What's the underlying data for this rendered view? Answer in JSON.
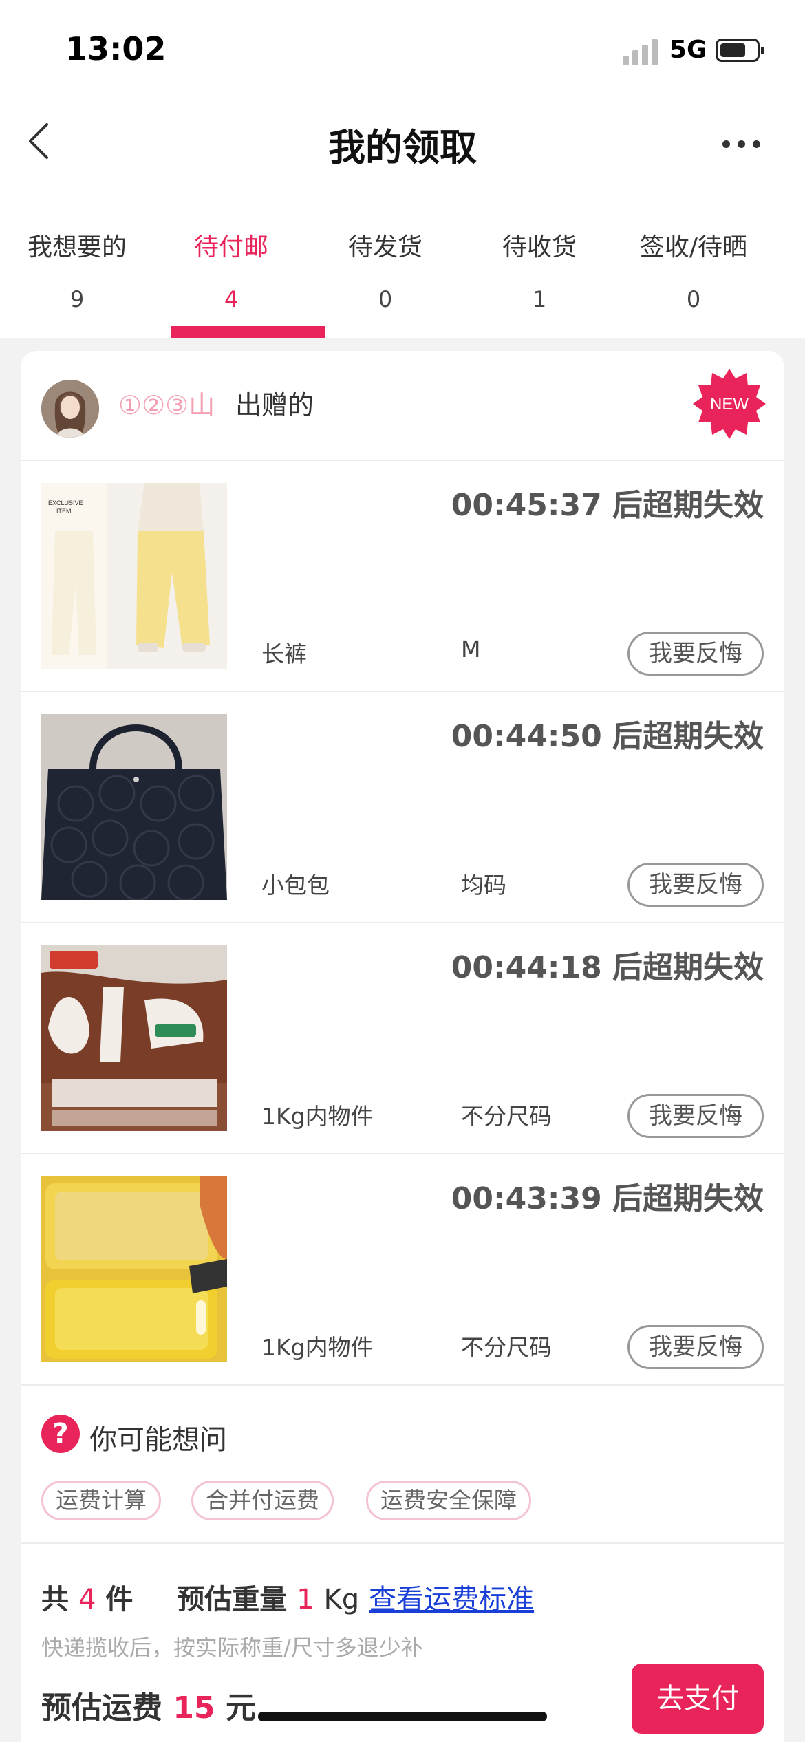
{
  "status_bar": {
    "time": "13:02",
    "network": "5G"
  },
  "header": {
    "title": "我的领取"
  },
  "tabs": [
    {
      "label": "我想要的",
      "count": "9"
    },
    {
      "label": "待付邮",
      "count": "4"
    },
    {
      "label": "待发货",
      "count": "0"
    },
    {
      "label": "待收货",
      "count": "1"
    },
    {
      "label": "签收/待晒",
      "count": "0"
    }
  ],
  "active_tab": "待付邮",
  "giver": {
    "name": "①②③山",
    "suffix": "出赠的",
    "badge": "NEW"
  },
  "items": [
    {
      "countdown": "00:45:37 后超期失效",
      "name": "长裤",
      "size": "M",
      "action": "我要反悔"
    },
    {
      "countdown": "00:44:50 后超期失效",
      "name": "小包包",
      "size": "均码",
      "action": "我要反悔"
    },
    {
      "countdown": "00:44:18 后超期失效",
      "name": "1Kg内物件",
      "size": "不分尺码",
      "action": "我要反悔"
    },
    {
      "countdown": "00:43:39 后超期失效",
      "name": "1Kg内物件",
      "size": "不分尺码",
      "action": "我要反悔"
    }
  ],
  "faq": {
    "title": "你可能想问",
    "chips": [
      "运费计算",
      "合并付运费",
      "运费安全保障"
    ]
  },
  "summary": {
    "prefix": "共",
    "count": "4",
    "count_unit": "件",
    "weight_label": "预估重量",
    "weight": "1",
    "weight_unit": "Kg",
    "link": "查看运费标准",
    "note": "快递揽收后，按实际称重/尺寸多退少补",
    "fee_label": "预估运费",
    "fee": "15",
    "fee_unit": "元",
    "pay_button": "去支付"
  },
  "colors": {
    "accent": "#e8245a",
    "link": "#1a3fd6"
  }
}
